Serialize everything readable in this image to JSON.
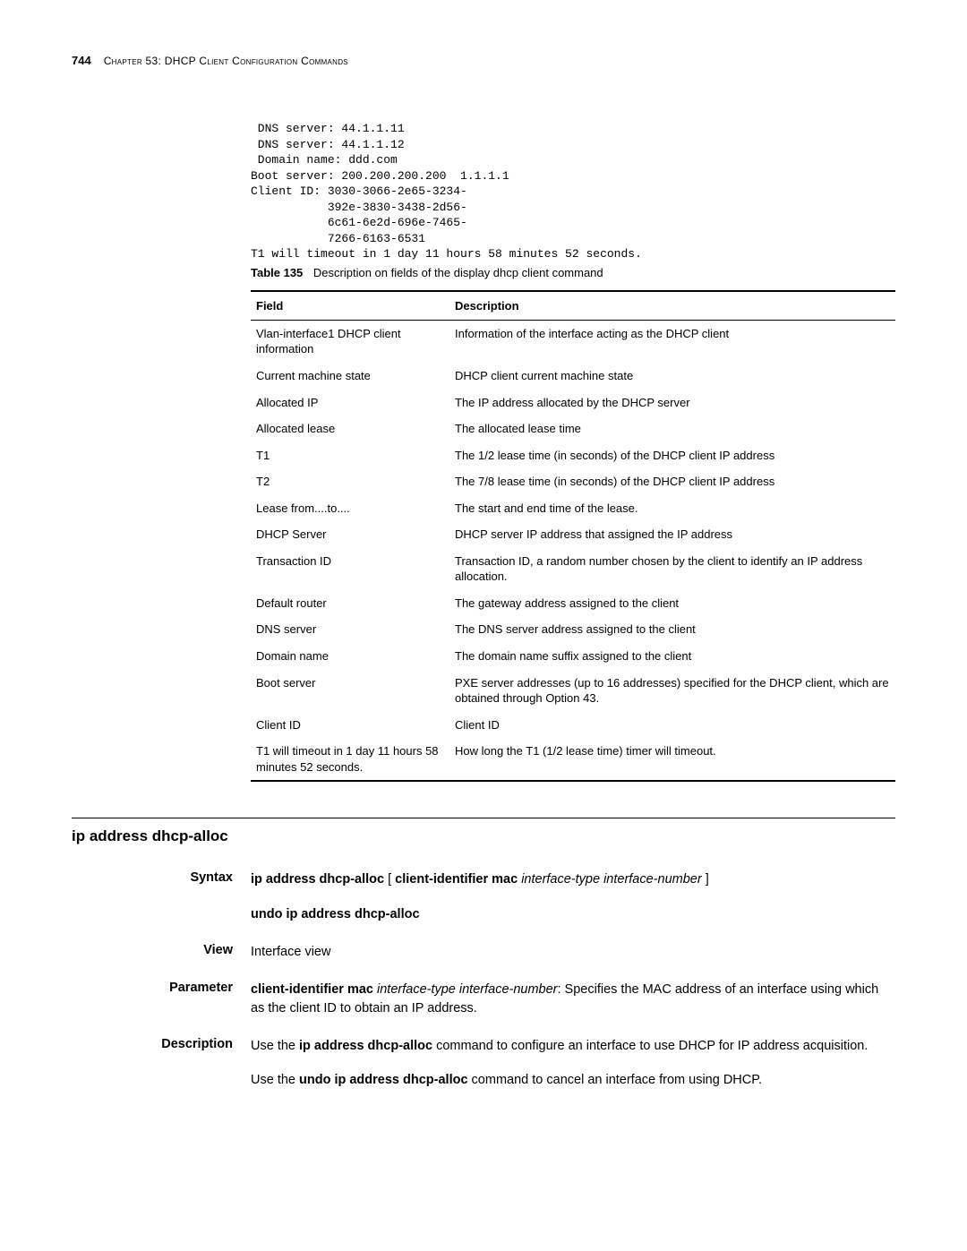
{
  "header": {
    "page_number": "744",
    "chapter": "Chapter 53: DHCP Client Configuration Commands"
  },
  "code": {
    "lines": " DNS server: 44.1.1.11\n DNS server: 44.1.1.12\n Domain name: ddd.com\nBoot server: 200.200.200.200  1.1.1.1\nClient ID: 3030-3066-2e65-3234-\n           392e-3830-3438-2d56-\n           6c61-6e2d-696e-7465-\n           7266-6163-6531\nT1 will timeout in 1 day 11 hours 58 minutes 52 seconds."
  },
  "table": {
    "caption_label": "Table 135",
    "caption_text": "Description on fields of the display dhcp client command",
    "headers": {
      "field": "Field",
      "description": "Description"
    },
    "rows": [
      {
        "field": "Vlan-interface1 DHCP client information",
        "desc": "Information of the interface acting as the DHCP client"
      },
      {
        "field": "Current machine state",
        "desc": "DHCP client current machine state"
      },
      {
        "field": "Allocated IP",
        "desc": "The IP address allocated by the DHCP server"
      },
      {
        "field": "Allocated lease",
        "desc": "The allocated lease time"
      },
      {
        "field": "T1",
        "desc": "The 1/2 lease time (in seconds) of the DHCP client IP address"
      },
      {
        "field": "T2",
        "desc": "The 7/8 lease time (in seconds) of the DHCP client IP address"
      },
      {
        "field": "Lease from....to....",
        "desc": "The start and end time of the lease."
      },
      {
        "field": "DHCP Server",
        "desc": "DHCP server IP address that assigned the IP address"
      },
      {
        "field": "Transaction ID",
        "desc": "Transaction ID, a random number chosen by the client to identify an IP address allocation."
      },
      {
        "field": "Default router",
        "desc": "The gateway address assigned to the client"
      },
      {
        "field": "DNS server",
        "desc": "The DNS server address assigned to the client"
      },
      {
        "field": "Domain name",
        "desc": "The domain name suffix assigned to the client"
      },
      {
        "field": "Boot server",
        "desc": "PXE server addresses (up to 16 addresses) specified for the DHCP client, which are obtained through Option 43."
      },
      {
        "field": "Client ID",
        "desc": "Client ID"
      },
      {
        "field": "T1 will timeout in 1 day 11 hours 58 minutes 52 seconds.",
        "desc": "How long the T1 (1/2 lease time) timer will timeout."
      }
    ]
  },
  "section": {
    "title": "ip address dhcp-alloc",
    "syntax": {
      "label": "Syntax",
      "cmd1_a": "ip address dhcp-alloc",
      "cmd1_b": " [ ",
      "cmd1_c": "client-identifier mac",
      "cmd1_d": " ",
      "cmd1_e": "interface-type interface-number",
      "cmd1_f": " ]",
      "cmd2": "undo ip address dhcp-alloc"
    },
    "view": {
      "label": "View",
      "text": "Interface view"
    },
    "parameter": {
      "label": "Parameter",
      "b1": "client-identifier mac",
      "i1": " interface-type interface-number",
      "t1": ": Specifies the MAC address of an interface using which as the client ID to obtain an IP address."
    },
    "description": {
      "label": "Description",
      "p1a": "Use the ",
      "p1b": "ip address dhcp-alloc",
      "p1c": " command to configure an interface to use DHCP for IP address acquisition.",
      "p2a": "Use the ",
      "p2b": "undo ip address dhcp-alloc",
      "p2c": " command to cancel an interface from using DHCP."
    }
  }
}
